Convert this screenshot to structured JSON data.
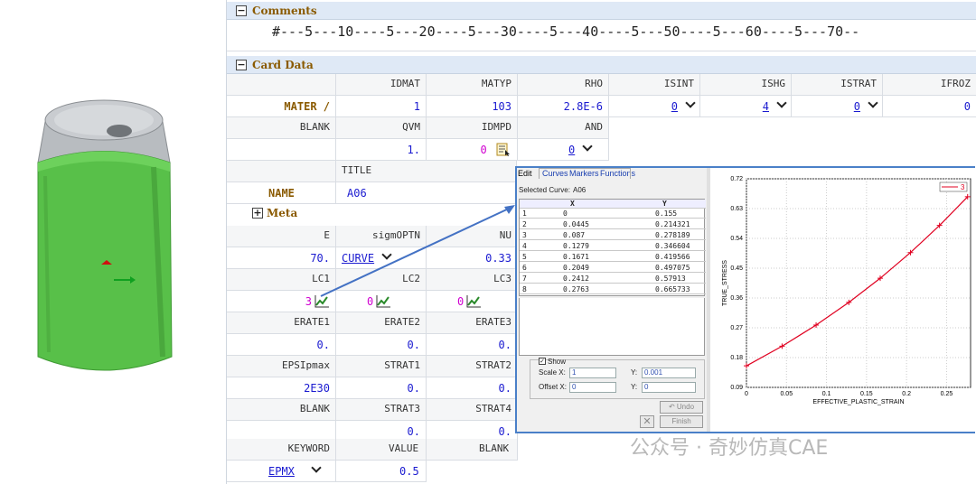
{
  "comments": {
    "title": "Comments",
    "ruler": "#---5---10----5---20----5---30----5---40----5---50----5---60----5---70--"
  },
  "card": {
    "title": "Card Data",
    "meta_title": "Meta",
    "row1": {
      "h": [
        "IDMAT",
        "MATYP",
        "RHO",
        "ISINT",
        "ISHG",
        "ISTRAT",
        "IFROZ"
      ],
      "label": "MATER /",
      "v": [
        "1",
        "103",
        "2.8E-6",
        "0",
        "4",
        "0",
        "0"
      ]
    },
    "row2": {
      "h": [
        "BLANK",
        "QVM",
        "IDMPD",
        "AND"
      ],
      "v": [
        "1.",
        "0",
        "0"
      ]
    },
    "row3": {
      "h": "TITLE",
      "label": "NAME",
      "v": "A06"
    },
    "row4": {
      "h": [
        "E",
        "sigmOPTN",
        "NU"
      ],
      "v": [
        "70.",
        "CURVE",
        "0.33"
      ]
    },
    "row5": {
      "h": [
        "LC1",
        "LC2",
        "LC3"
      ],
      "v": [
        "3",
        "0",
        "0"
      ]
    },
    "row6": {
      "h": [
        "ERATE1",
        "ERATE2",
        "ERATE3"
      ],
      "v": [
        "0.",
        "0.",
        "0."
      ]
    },
    "row7": {
      "h": [
        "EPSIpmax",
        "STRAT1",
        "STRAT2"
      ],
      "v": [
        "2E30",
        "0.",
        "0."
      ]
    },
    "row8": {
      "h": [
        "BLANK",
        "STRAT3",
        "STRAT4"
      ],
      "v": [
        "0.",
        "0."
      ]
    },
    "row9": {
      "h": [
        "KEYWORD",
        "VALUE",
        "BLANK"
      ],
      "v": [
        "EPMX",
        "0.5"
      ]
    }
  },
  "popup": {
    "tabs": [
      "Edit",
      "Curves",
      "Markers",
      "Functions"
    ],
    "selected_label": "Selected Curve:",
    "selected": "A06",
    "col_x": "X",
    "col_y": "Y",
    "rows": [
      [
        "1",
        "0",
        "0.155"
      ],
      [
        "2",
        "0.0445",
        "0.214321"
      ],
      [
        "3",
        "0.087",
        "0.278189"
      ],
      [
        "4",
        "0.1279",
        "0.346604"
      ],
      [
        "5",
        "0.1671",
        "0.419566"
      ],
      [
        "6",
        "0.2049",
        "0.497075"
      ],
      [
        "7",
        "0.2412",
        "0.57913"
      ],
      [
        "8",
        "0.2763",
        "0.665733"
      ]
    ],
    "show": "Show",
    "scale_x_label": "Scale X:",
    "scale_x": "1",
    "scale_y_label": "Y:",
    "scale_y": "0.001",
    "offset_x_label": "Offset X:",
    "offset_x": "0",
    "offset_y_label": "Y:",
    "offset_y": "0",
    "undo": "Undo",
    "finish": "Finish"
  },
  "chart_data": {
    "type": "line",
    "xlabel": "EFFECTIVE_PLASTIC_STRAIN",
    "ylabel": "TRUE_STRESS",
    "xlim": [
      0,
      0.28
    ],
    "ylim": [
      0.09,
      0.72
    ],
    "xticks": [
      "0",
      "0.05",
      "0.1",
      "0.15",
      "0.2",
      "0.25"
    ],
    "yticks": [
      "0.09",
      "0.18",
      "0.27",
      "0.36",
      "0.45",
      "0.54",
      "0.63",
      "0.72"
    ],
    "legend": "3",
    "color": "#e00020",
    "series": [
      {
        "name": "3",
        "x": [
          0,
          0.0445,
          0.087,
          0.1279,
          0.1671,
          0.2049,
          0.2412,
          0.2763
        ],
        "y": [
          0.155,
          0.214321,
          0.278189,
          0.346604,
          0.419566,
          0.497075,
          0.57913,
          0.665733
        ]
      }
    ]
  },
  "watermark": "公众号 · 奇妙仿真CAE"
}
